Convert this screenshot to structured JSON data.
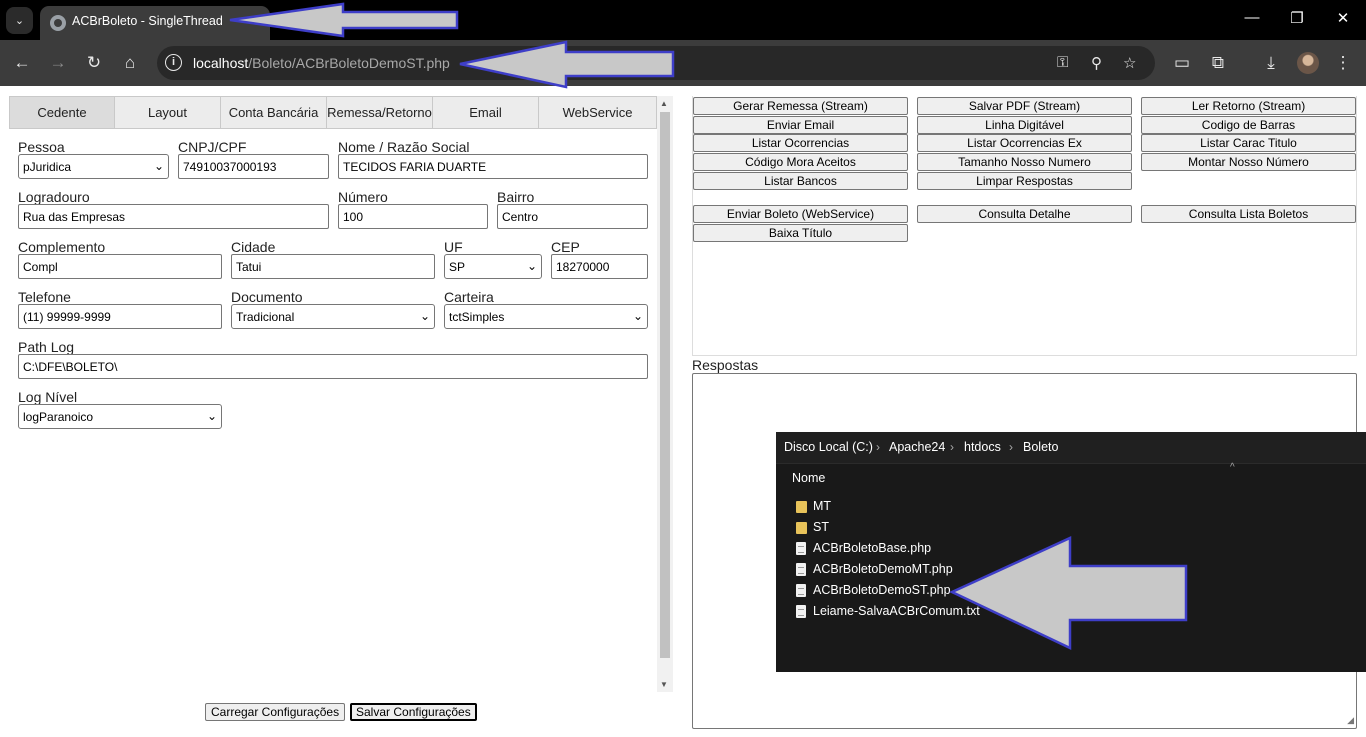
{
  "browser": {
    "tab_title": "ACBrBoleto - SingleThread",
    "new_tab_symbol": "+",
    "tab_menu_symbol": "⌄",
    "url_host": "localhost",
    "url_path": "/Boleto/ACBrBoletoDemoST.php",
    "window_controls": {
      "minimize": "—",
      "maximize": "❐",
      "close": "✕"
    },
    "nav": {
      "back": "←",
      "forward": "→",
      "reload": "↻",
      "home": "⌂"
    },
    "omnibox_icons": {
      "info": "i",
      "key": "⚿",
      "zoom": "⚲",
      "star": "☆"
    },
    "toolbar_icons": {
      "cast": "▭",
      "extensions": "⧉",
      "download": "⤓",
      "menu": "⋮"
    }
  },
  "config": {
    "tabs": [
      "Cedente",
      "Layout",
      "Conta Bancária",
      "Remessa/Retorno",
      "Email",
      "WebService"
    ],
    "fields": {
      "pessoa": {
        "label": "Pessoa",
        "value": "pJuridica"
      },
      "cnpj": {
        "label": "CNPJ/CPF",
        "value": "74910037000193"
      },
      "nome": {
        "label": "Nome / Razão Social",
        "value": "TECIDOS FARIA DUARTE"
      },
      "logradouro": {
        "label": "Logradouro",
        "value": "Rua das Empresas"
      },
      "numero": {
        "label": "Número",
        "value": "100"
      },
      "bairro": {
        "label": "Bairro",
        "value": "Centro"
      },
      "complemento": {
        "label": "Complemento",
        "value": "Compl"
      },
      "cidade": {
        "label": "Cidade",
        "value": "Tatui"
      },
      "uf": {
        "label": "UF",
        "value": "SP"
      },
      "cep": {
        "label": "CEP",
        "value": "18270000"
      },
      "telefone": {
        "label": "Telefone",
        "value": "(11) 99999-9999"
      },
      "documento": {
        "label": "Documento",
        "value": "Tradicional"
      },
      "carteira": {
        "label": "Carteira",
        "value": "tctSimples"
      },
      "path_log": {
        "label": "Path Log",
        "value": "C:\\DFE\\BOLETO\\"
      },
      "log_nivel": {
        "label": "Log Nível",
        "value": "logParanoico"
      }
    },
    "buttons": {
      "load": "Carregar Configurações",
      "save": "Salvar Configurações"
    },
    "select_arrow": "⌄",
    "scroll_up": "▲",
    "scroll_down": "▼"
  },
  "actions": {
    "col1": [
      "Gerar Remessa (Stream)",
      "Enviar Email",
      "Listar Ocorrencias",
      "Código Mora Aceitos",
      "Listar Bancos"
    ],
    "col2": [
      "Salvar PDF (Stream)",
      "Linha Digitável",
      "Listar Ocorrencias Ex",
      "Tamanho Nosso Numero",
      "Limpar Respostas"
    ],
    "col3": [
      "Ler Retorno (Stream)",
      "Codigo de Barras",
      "Listar Carac Titulo",
      "Montar Nosso Número"
    ],
    "webservice": [
      "Enviar Boleto (WebService)",
      "Consulta Detalhe",
      "Consulta Lista Boletos",
      "Baixa Título"
    ]
  },
  "respostas": {
    "label": "Respostas",
    "resize_symbol": "◢"
  },
  "explorer": {
    "breadcrumb": [
      "Disco Local (C:)",
      "Apache24",
      "htdocs",
      "Boleto"
    ],
    "separator": "›",
    "sort_symbol": "^",
    "column_header": "Nome",
    "items": [
      {
        "name": "MT",
        "type": "folder"
      },
      {
        "name": "ST",
        "type": "folder"
      },
      {
        "name": "ACBrBoletoBase.php",
        "type": "file"
      },
      {
        "name": "ACBrBoletoDemoMT.php",
        "type": "file"
      },
      {
        "name": "ACBrBoletoDemoST.php",
        "type": "file"
      },
      {
        "name": "Leiame-SalvaACBrComum.txt",
        "type": "file"
      }
    ]
  },
  "colors": {
    "arrow_fill": "#c8c8c8",
    "arrow_stroke": "#3e3ec8",
    "chrome_dark": "#000000",
    "toolbar": "#3c3c3c",
    "explorer_bg": "#191919"
  }
}
